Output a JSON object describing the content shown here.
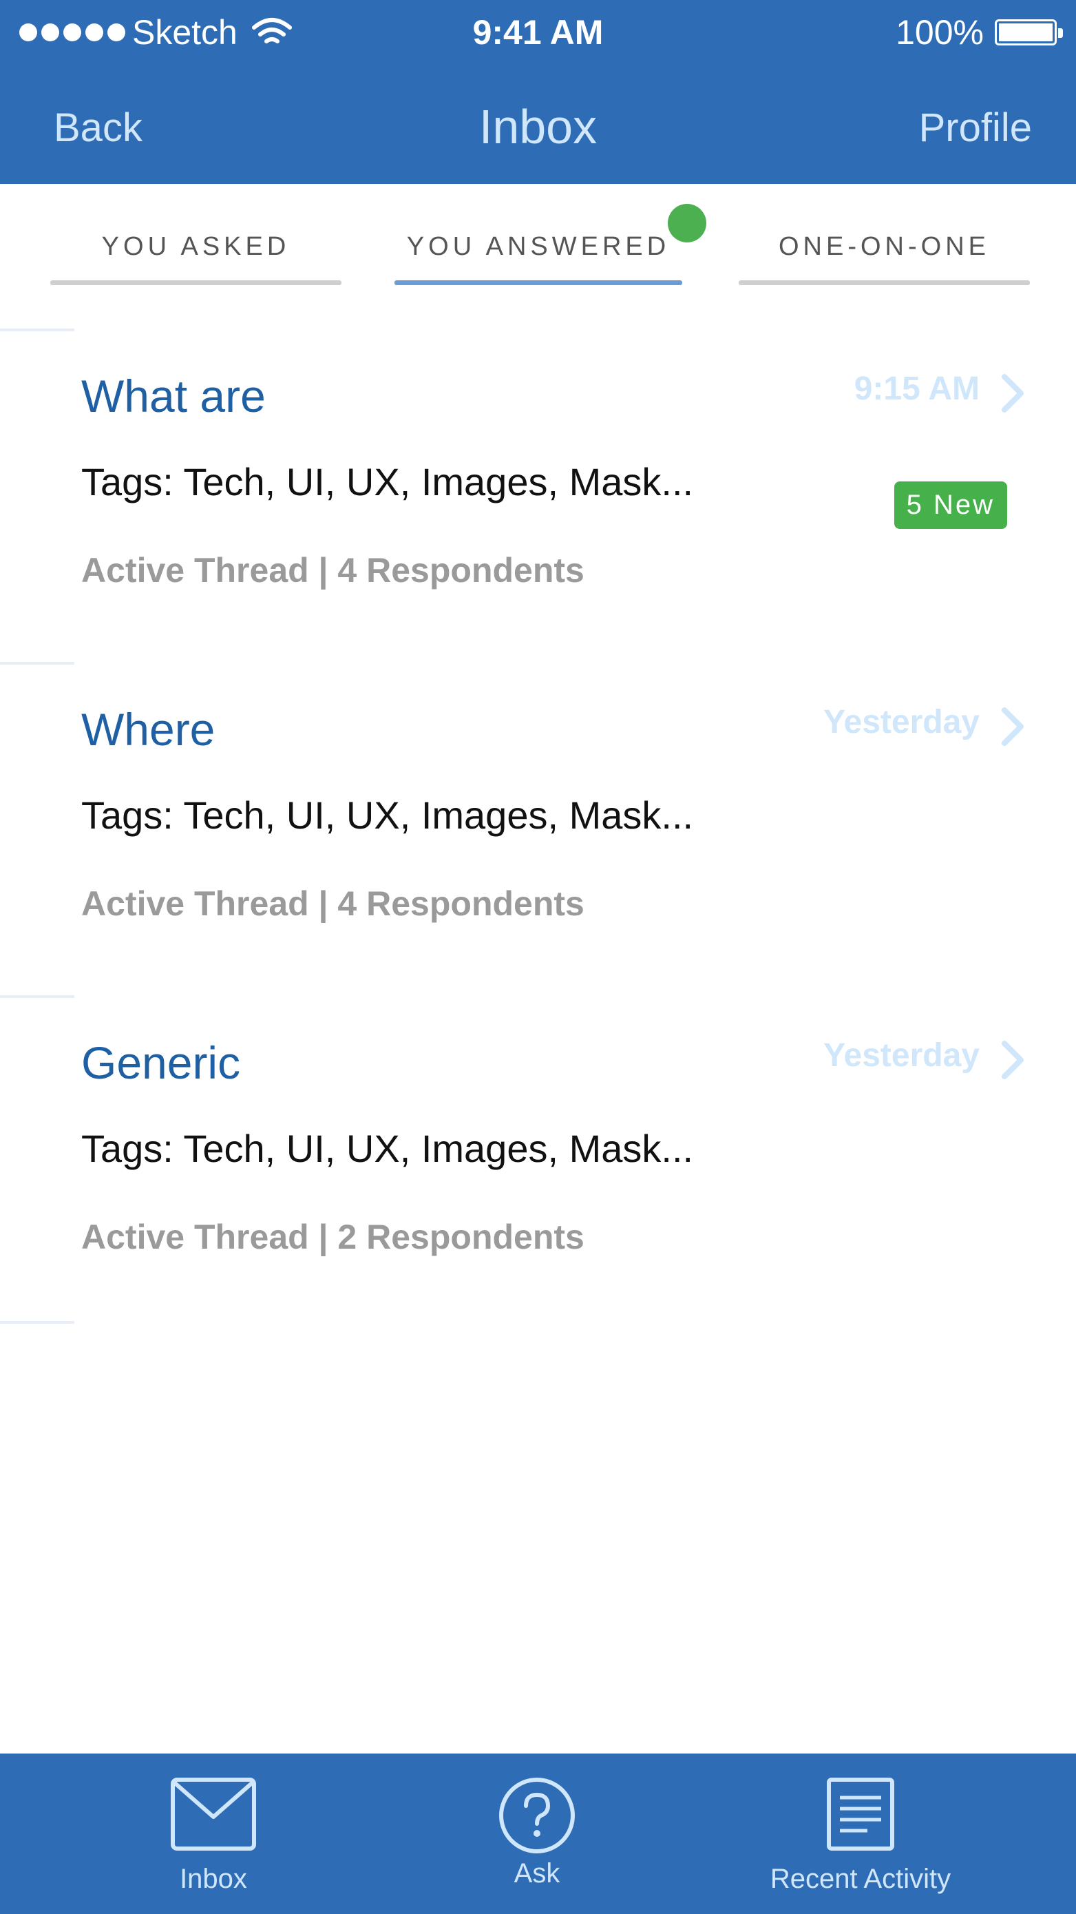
{
  "status_bar": {
    "carrier": "Sketch",
    "time": "9:41 AM",
    "battery": "100%"
  },
  "nav": {
    "back_label": "Back",
    "title": "Inbox",
    "profile_label": "Profile"
  },
  "tabs": [
    {
      "label": "YOU ASKED",
      "active": false
    },
    {
      "label": "YOU ANSWERED",
      "active": true
    },
    {
      "label": "ONE-ON-ONE",
      "active": false
    }
  ],
  "threads": [
    {
      "title": "What are",
      "time": "9:15 AM",
      "tags": "Tags: Tech, UI, UX, Images, Mask...",
      "meta": "Active Thread | 4 Respondents",
      "badge": "5 New"
    },
    {
      "title": "Where",
      "time": "Yesterday",
      "tags": "Tags: Tech, UI, UX, Images, Mask...",
      "meta": "Active Thread | 4 Respondents"
    },
    {
      "title": "Generic",
      "time": "Yesterday",
      "tags": "Tags: Tech, UI, UX, Images, Mask...",
      "meta": "Active Thread | 2 Respondents"
    }
  ],
  "tab_bar": [
    {
      "label": "Inbox",
      "icon": "envelope-icon"
    },
    {
      "label": "Ask",
      "icon": "question-circle-icon"
    },
    {
      "label": "Recent Activity",
      "icon": "document-icon"
    }
  ],
  "colors": {
    "primary": "#2e6db5",
    "accent_light": "#cfe6fb",
    "badge_green": "#46b04a",
    "title_blue": "#1f5fa3"
  }
}
